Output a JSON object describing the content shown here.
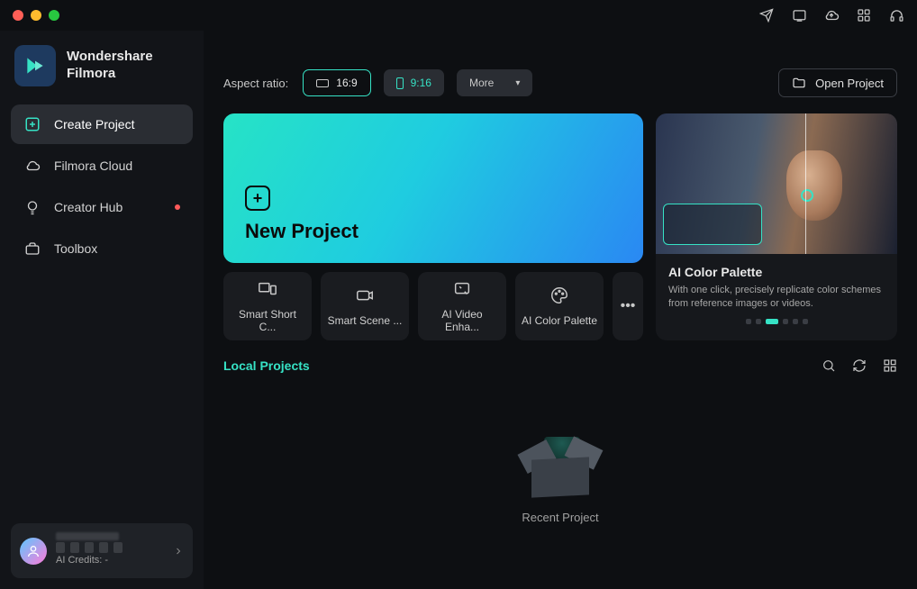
{
  "brand": {
    "line1": "Wondershare",
    "line2": "Filmora"
  },
  "sidebar": {
    "items": [
      {
        "label": "Create Project"
      },
      {
        "label": "Filmora Cloud"
      },
      {
        "label": "Creator Hub"
      },
      {
        "label": "Toolbox"
      }
    ]
  },
  "toprow": {
    "label": "Aspect ratio:",
    "ratio_169": "16:9",
    "ratio_916": "9:16",
    "more": "More",
    "open_project": "Open Project"
  },
  "new_project": {
    "title": "New Project"
  },
  "tools": [
    "Smart Short C...",
    "Smart Scene ...",
    "AI Video Enha...",
    "AI Color Palette"
  ],
  "feature": {
    "title": "AI Color Palette",
    "desc": "With one click, precisely replicate color schemes from reference images or videos."
  },
  "section": {
    "title": "Local Projects"
  },
  "recent": {
    "label": "Recent Project"
  },
  "profile": {
    "credits": "AI Credits: -"
  }
}
